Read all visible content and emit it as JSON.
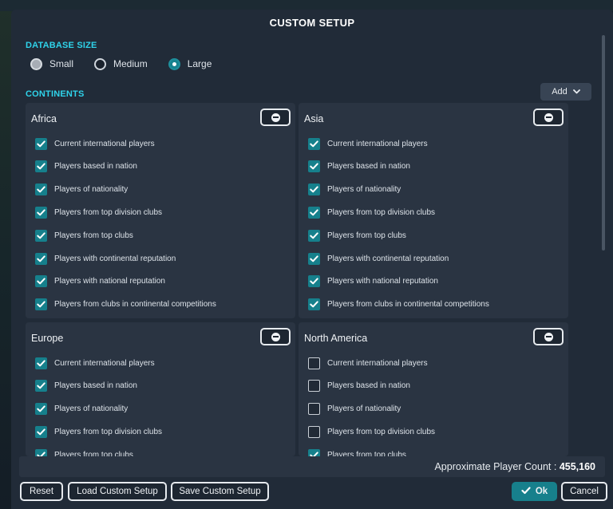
{
  "dialog": {
    "title": "CUSTOM SETUP"
  },
  "database_size": {
    "label": "DATABASE SIZE",
    "options": [
      {
        "label": "Small",
        "selected": false
      },
      {
        "label": "Medium",
        "selected": false
      },
      {
        "label": "Large",
        "selected": true
      }
    ]
  },
  "continents": {
    "label": "CONTINENTS",
    "add_label": "Add",
    "panels": [
      {
        "name": "Africa",
        "options": [
          {
            "label": "Current international players",
            "checked": true
          },
          {
            "label": "Players based in nation",
            "checked": true
          },
          {
            "label": "Players of nationality",
            "checked": true
          },
          {
            "label": "Players from top division clubs",
            "checked": true
          },
          {
            "label": "Players from top clubs",
            "checked": true
          },
          {
            "label": "Players with continental reputation",
            "checked": true
          },
          {
            "label": "Players with national reputation",
            "checked": true
          },
          {
            "label": "Players from clubs in continental competitions",
            "checked": true
          }
        ]
      },
      {
        "name": "Asia",
        "options": [
          {
            "label": "Current international players",
            "checked": true
          },
          {
            "label": "Players based in nation",
            "checked": true
          },
          {
            "label": "Players of nationality",
            "checked": true
          },
          {
            "label": "Players from top division clubs",
            "checked": true
          },
          {
            "label": "Players from top clubs",
            "checked": true
          },
          {
            "label": "Players with continental reputation",
            "checked": true
          },
          {
            "label": "Players with national reputation",
            "checked": true
          },
          {
            "label": "Players from clubs in continental competitions",
            "checked": true
          }
        ]
      },
      {
        "name": "Europe",
        "options": [
          {
            "label": "Current international players",
            "checked": true
          },
          {
            "label": "Players based in nation",
            "checked": true
          },
          {
            "label": "Players of nationality",
            "checked": true
          },
          {
            "label": "Players from top division clubs",
            "checked": true
          },
          {
            "label": "Players from top clubs",
            "checked": true
          }
        ]
      },
      {
        "name": "North America",
        "options": [
          {
            "label": "Current international players",
            "checked": false
          },
          {
            "label": "Players based in nation",
            "checked": false
          },
          {
            "label": "Players of nationality",
            "checked": false
          },
          {
            "label": "Players from top division clubs",
            "checked": false
          },
          {
            "label": "Players from top clubs",
            "checked": true
          }
        ]
      }
    ]
  },
  "footer": {
    "count_label": "Approximate Player Count :",
    "count_value": "455,160",
    "reset_label": "Reset",
    "load_label": "Load Custom Setup",
    "save_label": "Save Custom Setup",
    "ok_label": "Ok",
    "cancel_label": "Cancel"
  },
  "icons": {
    "radio": "radio-icon",
    "add_chevron": "chevron-down-icon",
    "remove": "minus-circle-icon",
    "checkbox": "checkbox-icon",
    "ok_check": "checkmark-icon"
  },
  "colors": {
    "accent": "#17808c",
    "section_label": "#2fd3ea",
    "panel_bg": "#2a3442",
    "dialog_bg": "#212b38"
  }
}
